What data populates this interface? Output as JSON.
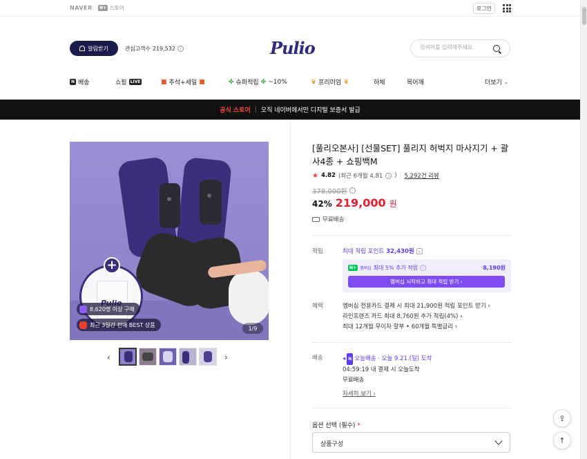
{
  "naver_bar": {
    "naver_label": "NAVER",
    "store_prefix": "N+",
    "store_label": "스토어",
    "login_label": "로그인"
  },
  "header": {
    "alarm_label": "알림받기",
    "followers_label": "관심고객수",
    "followers_count": "219,532",
    "brand_name": "Pulio",
    "search_placeholder": "검색어를 입력해주세요"
  },
  "nav": {
    "items": [
      {
        "tag": "N",
        "label": "배송"
      },
      {
        "label": "쇼핑",
        "tag": "LIVE"
      },
      {
        "label": "추석+세일"
      },
      {
        "label": "슈퍼적립",
        "suffix": "~10%"
      },
      {
        "label": "프리미엄"
      },
      {
        "label": "하체"
      },
      {
        "label": "목어깨"
      }
    ],
    "more_label": "더보기"
  },
  "banner": {
    "official": "공식 스토어",
    "text": "오직 네이버에서만 디지털 보증서 발급"
  },
  "gallery": {
    "bag_text": "Pulio",
    "pill_buyers": "8,620명 이상 구매",
    "pill_best": "최근 3일간 판매 BEST 상품",
    "counter": "1/9",
    "thumbnail_count": 5
  },
  "product": {
    "title": "[풀리오본사] [선물SET] 풀리지 허벅지 마사지기 + 괄사4종 + 쇼핑백M",
    "rating": "4.82",
    "rating_recent": "(최근 6개월 4.81",
    "rating_recent_close": ")",
    "review_count": "5,292건 리뷰",
    "original_price": "378,000원",
    "discount": "42%",
    "price": "219,000",
    "price_unit": "원",
    "shipping": "무료배송"
  },
  "points": {
    "label": "적립",
    "title": "최대 적립 포인트",
    "amount": "32,430원",
    "member_badge": "N+",
    "member_badge_text": "멤버십",
    "member_text": "최대 5% 추가 적립",
    "member_amount": "8,190원",
    "member_button": "멤버십 시작하고 최대 적립 받기"
  },
  "benefits": {
    "label": "혜택",
    "lines": [
      "멤버십 전용카드 결제 시 최대 21,900원 적립 포인트 받기",
      "라인프렌즈 카드 최대 8,760원 추가 적립(4%)",
      "최대 12개월 무이자 할부 • 60개월 특별금리"
    ]
  },
  "delivery": {
    "label": "배송",
    "today_tag": "N",
    "today_label": "오늘배송",
    "arrival": "오늘 9.21.(일) 도착",
    "cutoff": "04:59:19  내 결제 시 오늘도착",
    "fee": "무료배송",
    "detail_link": "자세히 보기"
  },
  "option": {
    "label": "옵션 선택 (필수)",
    "required_mark": "*",
    "select_value": "상품구성"
  },
  "colors": {
    "brand": "#2f2a7a",
    "price": "#e6202e",
    "accent": "#5b3df5",
    "banner": "#111111"
  }
}
